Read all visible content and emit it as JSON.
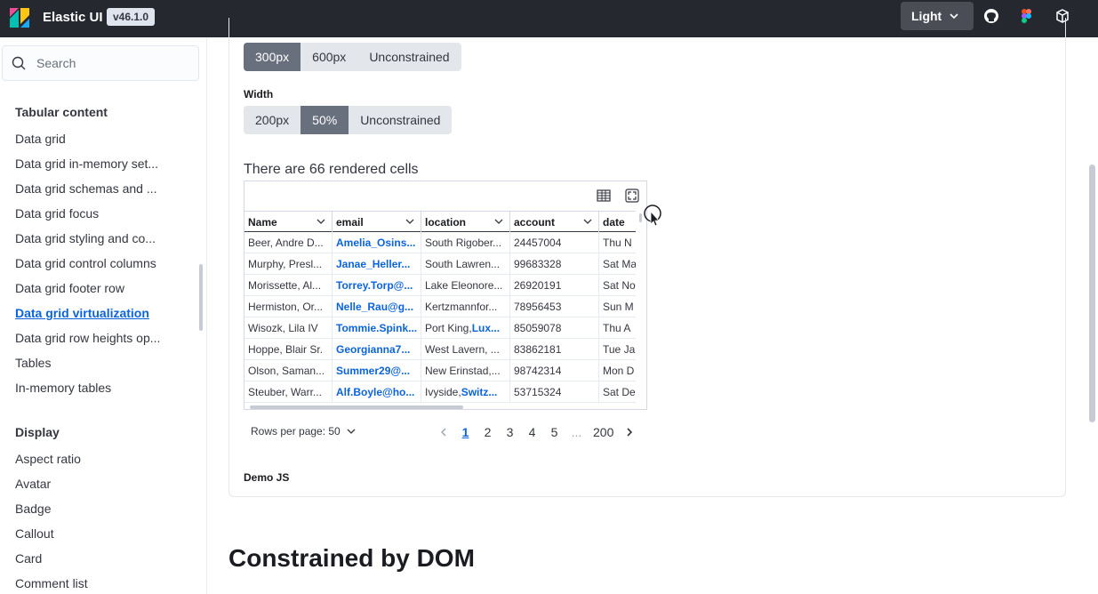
{
  "header": {
    "brand": "Elastic UI",
    "version": "v46.1.0",
    "theme_label": "Light",
    "icons": [
      "github-icon",
      "figma-icon",
      "codesandbox-icon"
    ]
  },
  "sidebar": {
    "search_placeholder": "Search",
    "groups": [
      {
        "heading": "Tabular content",
        "items": [
          "Data grid",
          "Data grid in-memory set...",
          "Data grid schemas and ...",
          "Data grid focus",
          "Data grid styling and co...",
          "Data grid control columns",
          "Data grid footer row",
          "Data grid virtualization",
          "Data grid row heights op...",
          "Tables",
          "In-memory tables"
        ],
        "active_index": 7
      },
      {
        "heading": "Display",
        "items": [
          "Aspect ratio",
          "Avatar",
          "Badge",
          "Callout",
          "Card",
          "Comment list"
        ]
      }
    ]
  },
  "height_control": {
    "options": [
      "300px",
      "600px",
      "Unconstrained"
    ],
    "selected": "300px"
  },
  "width_control": {
    "label": "Width",
    "options": [
      "200px",
      "50%",
      "Unconstrained"
    ],
    "selected": "50%"
  },
  "rendered_cells_text": "There are 66 rendered cells",
  "grid": {
    "columns": [
      "Name",
      "email",
      "location",
      "account",
      "date"
    ],
    "rows": [
      {
        "name": "Beer, Andre D...",
        "email": "Amelia_Osins...",
        "location": "South Rigober...",
        "location_link": "",
        "account": "24457004",
        "date": "Thu N"
      },
      {
        "name": "Murphy, Presl...",
        "email": "Janae_Heller...",
        "location": "South Lawren...",
        "location_link": "",
        "account": "99683328",
        "date": "Sat Ma"
      },
      {
        "name": "Morissette, Al...",
        "email": "Torrey.Torp@...",
        "location": "Lake Eleonore...",
        "location_link": "",
        "account": "26920191",
        "date": "Sat No"
      },
      {
        "name": "Hermiston, Or...",
        "email": "Nelle_Rau@g...",
        "location": "Kertzmannfor...",
        "location_link": "",
        "account": "78956453",
        "date": "Sun M"
      },
      {
        "name": "Wisozk, Lila IV",
        "email": "Tommie.Spink...",
        "location": "Port King, ",
        "location_link": "Lux...",
        "account": "85059078",
        "date": "Thu A"
      },
      {
        "name": "Hoppe, Blair Sr.",
        "email": "Georgianna7...",
        "location": "West Lavern, ...",
        "location_link": "",
        "account": "83862181",
        "date": "Tue Ja"
      },
      {
        "name": "Olson, Saman...",
        "email": "Summer29@...",
        "location": "New Erinstad,...",
        "location_link": "",
        "account": "98742314",
        "date": "Mon D"
      },
      {
        "name": "Steuber, Warr...",
        "email": "Alf.Boyle@ho...",
        "location": "Ivyside, ",
        "location_link": "Switz...",
        "account": "53715324",
        "date": "Sat De"
      }
    ]
  },
  "pagination": {
    "rows_per_page": "Rows per page: 50",
    "pages": [
      "1",
      "2",
      "3",
      "4",
      "5",
      "...",
      "200"
    ],
    "current": "1"
  },
  "demo_js_label": "Demo JS",
  "section_title": "Constrained by DOM",
  "colors": {
    "accent": "#0b64dd",
    "header_bg": "#25282f",
    "selected_segment": "#69707d"
  }
}
